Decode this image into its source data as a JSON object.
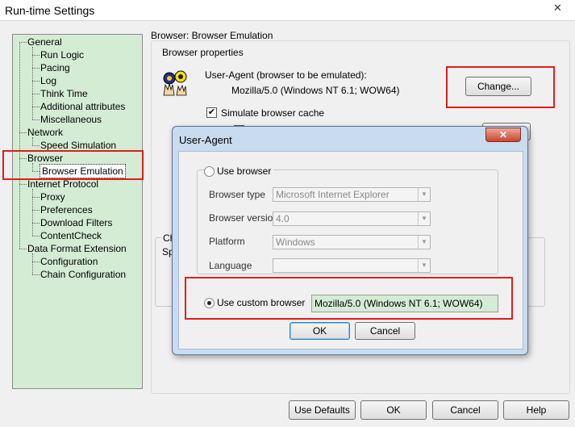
{
  "window": {
    "title": "Run-time Settings",
    "close_glyph": "✕"
  },
  "tree": {
    "items": [
      {
        "label": "General",
        "level": 0
      },
      {
        "label": "Run Logic",
        "level": 1
      },
      {
        "label": "Pacing",
        "level": 1
      },
      {
        "label": "Log",
        "level": 1
      },
      {
        "label": "Think Time",
        "level": 1
      },
      {
        "label": "Additional attributes",
        "level": 1
      },
      {
        "label": "Miscellaneous",
        "level": 1
      },
      {
        "label": "Network",
        "level": 0
      },
      {
        "label": "Speed Simulation",
        "level": 1
      },
      {
        "label": "Browser",
        "level": 0
      },
      {
        "label": "Browser Emulation",
        "level": 1,
        "selected": true
      },
      {
        "label": "Internet Protocol",
        "level": 0
      },
      {
        "label": "Proxy",
        "level": 1
      },
      {
        "label": "Preferences",
        "level": 1
      },
      {
        "label": "Download Filters",
        "level": 1
      },
      {
        "label": "ContentCheck",
        "level": 1
      },
      {
        "label": "Data Format Extension",
        "level": 0
      },
      {
        "label": "Configuration",
        "level": 1
      },
      {
        "label": "Chain Configuration",
        "level": 1
      }
    ]
  },
  "panel": {
    "title": "Browser: Browser Emulation",
    "props_label": "Browser properties",
    "ua_label": "User-Agent (browser to be emulated):",
    "ua_value": "Mozilla/5.0 (Windows NT 6.1; WOW64)",
    "change_label": "Change...",
    "simulate_cache_label": "Simulate browser cache",
    "partial_group_label": "Ch",
    "partial_text": "Sp"
  },
  "dialog": {
    "title": "User-Agent",
    "close_glyph": "✕",
    "use_browser_label": "Use browser",
    "browser_type_label": "Browser type",
    "browser_type_value": "Microsoft Internet Explorer",
    "browser_version_label": "Browser version",
    "browser_version_value": "4.0",
    "platform_label": "Platform",
    "platform_value": "Windows",
    "language_label": "Language",
    "language_value": "",
    "use_custom_label": "Use custom browser",
    "custom_value": "Mozilla/5.0 (Windows NT 6.1; WOW64)",
    "ok_label": "OK",
    "cancel_label": "Cancel"
  },
  "footer": {
    "use_defaults_label": "Use Defaults",
    "ok_label": "OK",
    "cancel_label": "Cancel",
    "help_label": "Help"
  },
  "colors": {
    "highlight_red": "#e21d1d",
    "tree_bg": "#d4ecd4",
    "custom_field_bg": "#d4ecd4"
  }
}
